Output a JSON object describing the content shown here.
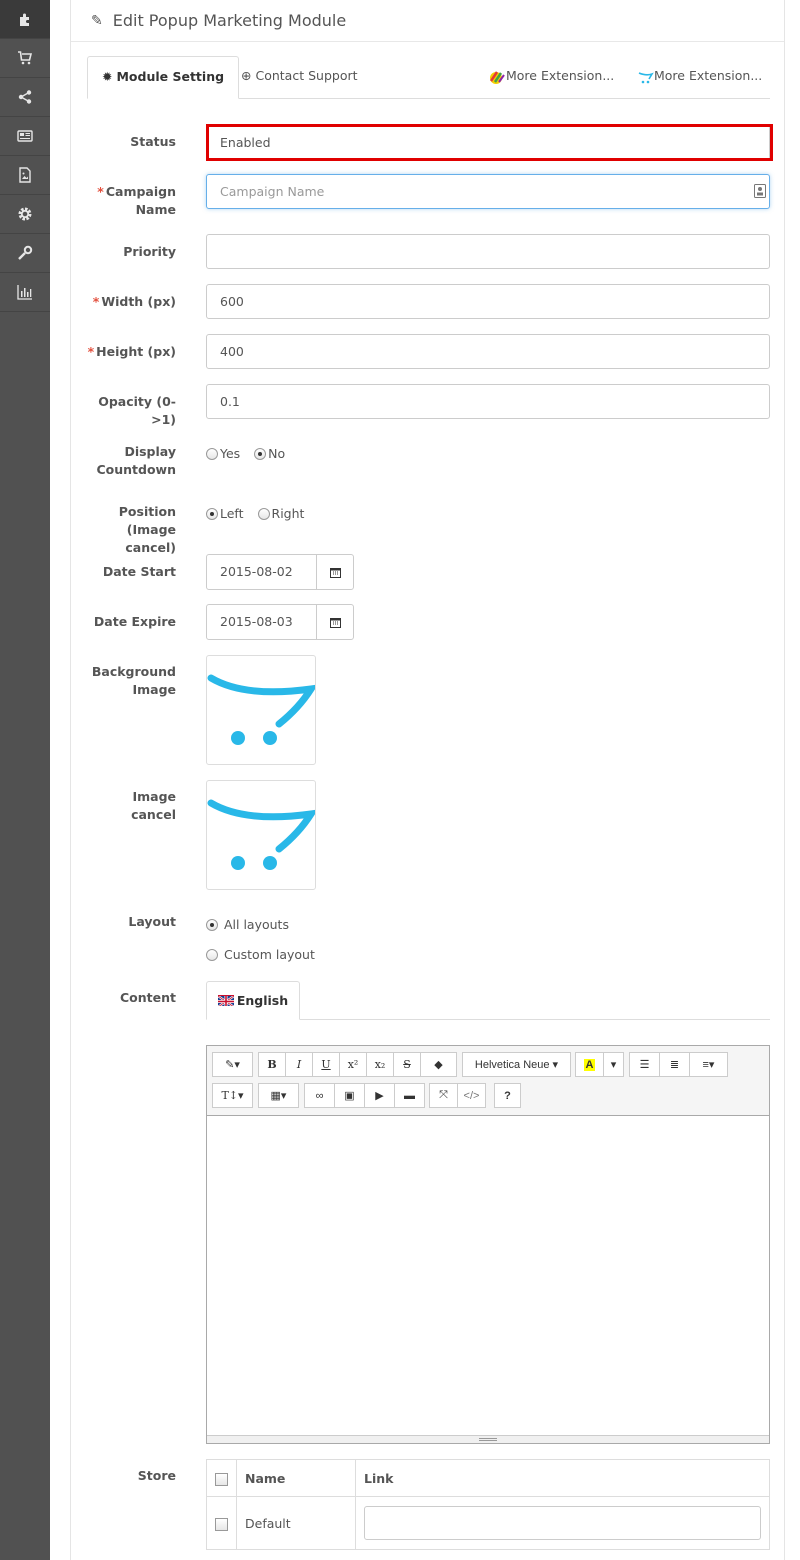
{
  "sidebar": {
    "items": [
      {
        "icon": "puzzle-icon",
        "active": true
      },
      {
        "icon": "cart-icon"
      },
      {
        "icon": "share-icon"
      },
      {
        "icon": "newspaper-icon"
      },
      {
        "icon": "image-file-icon"
      },
      {
        "icon": "gear-icon"
      },
      {
        "icon": "wrench-icon"
      },
      {
        "icon": "bar-chart-icon"
      }
    ]
  },
  "header": {
    "title": "Edit Popup Marketing Module"
  },
  "tabs": [
    {
      "label": "Module Setting",
      "icon": "gear-icon",
      "active": true
    },
    {
      "label": "Contact Support",
      "icon": "life-ring-icon"
    },
    {
      "label": "More Extension...",
      "icon": "colorful-logo-icon"
    },
    {
      "label": "More Extension...",
      "icon": "opencart-logo-icon"
    }
  ],
  "form": {
    "status": {
      "label": "Status",
      "value": "Enabled"
    },
    "campaign_name": {
      "label": "Campaign Name",
      "value": "",
      "placeholder": "Campaign Name",
      "required": true
    },
    "priority": {
      "label": "Priority",
      "value": ""
    },
    "width": {
      "label": "Width (px)",
      "value": "600",
      "required": true
    },
    "height": {
      "label": "Height (px)",
      "value": "400",
      "required": true
    },
    "opacity": {
      "label": "Opacity (0->1)",
      "value": "0.1"
    },
    "display_countdown": {
      "label": "Display Countdown",
      "options": [
        "Yes",
        "No"
      ],
      "selected": "No"
    },
    "position": {
      "label": "Position (Image cancel)",
      "options": [
        "Left",
        "Right"
      ],
      "selected": "Left"
    },
    "date_start": {
      "label": "Date Start",
      "value": "2015-08-02"
    },
    "date_expire": {
      "label": "Date Expire",
      "value": "2015-08-03"
    },
    "background_image": {
      "label": "Background Image"
    },
    "image_cancel": {
      "label": "Image cancel"
    },
    "layout": {
      "label": "Layout",
      "options": [
        "All layouts",
        "Custom layout"
      ],
      "selected": "All layouts"
    },
    "content": {
      "label": "Content",
      "language_tab": "English"
    },
    "store": {
      "label": "Store",
      "columns": [
        "Name",
        "Link"
      ],
      "rows": [
        {
          "name": "Default",
          "link": ""
        }
      ]
    }
  },
  "editor": {
    "font_name": "Helvetica Neue",
    "toolbar_labels": {
      "bold": "B",
      "italic": "I",
      "underline": "U",
      "superscript": "x²",
      "subscript": "x₂",
      "strike": "S",
      "help": "?"
    }
  },
  "colors": {
    "required": "#e3503e",
    "highlight": "#e00000",
    "sidebar": "#515151",
    "logo_blue": "#29b8e8"
  }
}
